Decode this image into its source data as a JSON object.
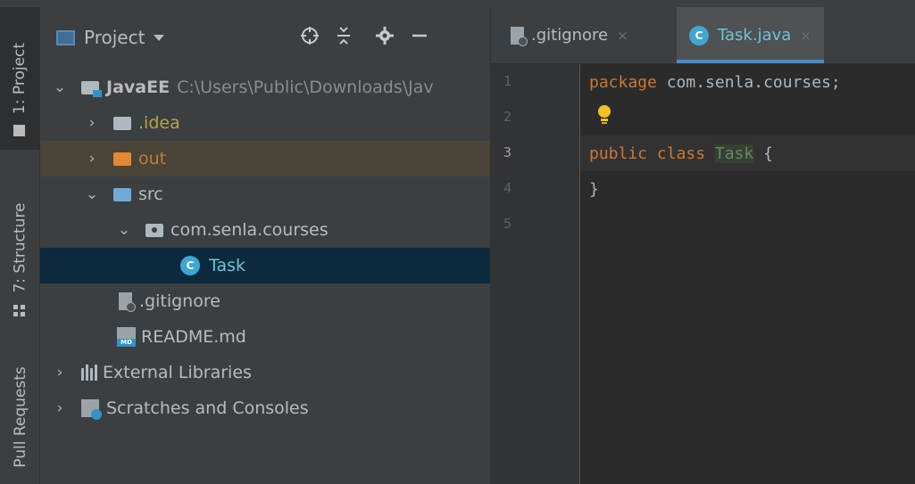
{
  "sidebar": {
    "tabs": [
      {
        "label": "1: Project",
        "icon": "folder-icon"
      },
      {
        "label": "7: Structure",
        "icon": "structure-icon"
      },
      {
        "label": "Pull Requests",
        "icon": "pull-request-icon"
      }
    ]
  },
  "project_panel": {
    "title": "Project",
    "header_buttons": [
      "locate-icon",
      "collapse-icon",
      "gear-icon",
      "hide-icon"
    ],
    "tree": {
      "root": {
        "name": "JavaEE",
        "path": "C:\\Users\\Public\\Downloads\\Jav"
      },
      "idea": ".idea",
      "out": "out",
      "src": "src",
      "package": "com.senla.courses",
      "task": "Task",
      "gitignore": ".gitignore",
      "readme": "README.md",
      "readme_badge": "MD",
      "external_libraries": "External Libraries",
      "scratches": "Scratches and Consoles"
    }
  },
  "editor": {
    "tabs": [
      {
        "label": ".gitignore",
        "icon": "gitignore-icon",
        "close": "×"
      },
      {
        "label": "Task.java",
        "icon": "class-icon",
        "close": "×",
        "active": true
      }
    ],
    "class_badge": "C",
    "line_numbers": [
      "1",
      "2",
      "3",
      "4",
      "5"
    ],
    "code": {
      "line1_kw": "package",
      "line1_rest": " com.senla.courses;",
      "line3_kw1": "public",
      "line3_kw2": "class",
      "line3_name": "Task",
      "line3_rest": " {",
      "line4": "}"
    }
  },
  "colors": {
    "keyword": "#cc7832",
    "class_name": "#6a8759",
    "selection": "#0d293e",
    "accent": "#4a88c7"
  }
}
